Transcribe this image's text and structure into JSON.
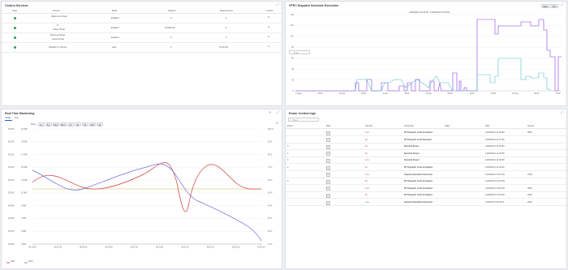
{
  "colors": {
    "ok": "#2e9b5c",
    "purple": "#8c3ce6",
    "teal": "#54c2d0",
    "red": "#d03a3a",
    "blue": "#6b6bd8",
    "olive": "#b9b94a"
  },
  "control_services": {
    "title": "Control Services",
    "columns": [
      "State",
      "Service",
      "Mode",
      "Setpoint",
      "Measurement",
      "Control"
    ],
    "rows": [
      {
        "service": "Reference Power",
        "sub": "",
        "mode": "Enabled",
        "setpoint": "0",
        "measurement": "0"
      },
      {
        "service": "Fr",
        "sub": "Active Power",
        "mode": "Enabled",
        "setpoint": "70,000 kW",
        "measurement": "0"
      },
      {
        "service": "Ramp-up Reset",
        "sub": "Active Power",
        "mode": "Enabled",
        "setpoint": "0",
        "measurement": "0"
      },
      {
        "service": "Dispatch P: Service",
        "sub": "",
        "mode": "Auto",
        "setpoint": "0",
        "measurement": "70,00 kW"
      }
    ]
  },
  "vpp": {
    "title": "VPPC Dispatch Schedule Execution",
    "buttons": [
      "Table",
      "Plot"
    ],
    "legend": "14/09/2021 00:26:59 - 14/09/2021 00:26:59",
    "search_placeholder": "Filter",
    "y_ticks": [
      "140",
      "120",
      "100",
      "80",
      "60",
      "40",
      "20",
      "0"
    ],
    "x_ticks": [
      "11 Sep",
      "18:00",
      "12 Sep",
      "06:00",
      "12:00",
      "18:00",
      "13 Sep",
      "06:00",
      "12:00",
      "18:00",
      "14 Sep",
      "06:00",
      "12:00"
    ]
  },
  "realtime": {
    "title": "Real Time Monitoring",
    "tabs": [
      "Prop",
      "Ana"
    ],
    "zoom_label": "Zoom",
    "zoom_buttons": [
      "1m",
      "5m",
      "10m",
      "30m",
      "1h",
      "3h",
      "6h",
      "12h",
      "All"
    ],
    "y_left_ticks": [
      "50.050",
      "50.040",
      "50.030",
      "50.020",
      "50.010",
      "50.000",
      "49.990",
      "49.980",
      "49.970",
      "49.960"
    ],
    "y_mid_ticks": [
      "21 MW",
      "19 MW",
      "17 MW",
      "15 MW",
      "13 MW",
      "11 MW",
      "9 MW",
      "7 MW",
      "5 MW",
      "3 MW"
    ],
    "y_right_ticks": [
      "100 %",
      "90 %",
      "80 %",
      "70 %",
      "60 %",
      "50 %",
      "40 %",
      "30 %",
      "20 %",
      "10 %"
    ],
    "x_ticks": [
      "08:10:40",
      "08:10:45",
      "08:10:50",
      "08:10:55",
      "08:11:00",
      "08:11:05",
      "08:11:10",
      "08:11:15",
      "08:11:20",
      "08:11:25"
    ],
    "legend": [
      "SOF",
      "SOC"
    ]
  },
  "log": {
    "title": "Power Control logs",
    "search_placeholder": "Filter",
    "columns": [
      "Event",
      "Role",
      "Severity",
      "Parameter",
      "Value",
      "Date",
      "Source"
    ],
    "rows": [
      {
        "event": "",
        "severity": "Low",
        "parameter": "RT Dispatch Limit Activation",
        "value": "",
        "date": "14/09/2021 11:26:59",
        "source": "2000"
      },
      {
        "event": "",
        "severity": "Hi",
        "parameter": "RT Dispatch Limit Reached",
        "value": "",
        "date": "14/09/2021 11:13:39",
        "source": ""
      },
      {
        "event": "0",
        "severity": "Hi",
        "parameter": "Nominal Power",
        "value": "",
        "date": "14/09/2021 11:26:59",
        "source": ""
      },
      {
        "event": "1",
        "severity": "Hi",
        "parameter": "Nominal Power",
        "value": "",
        "date": "14/09/2021 11:26:59",
        "source": ""
      },
      {
        "event": "0",
        "severity": "Low",
        "parameter": "Nominal Power",
        "value": "",
        "date": "14/09/2021 11:06:59",
        "source": ""
      },
      {
        "event": "2",
        "severity": "Hi",
        "parameter": "RT Dispatch Limit Activation",
        "value": "",
        "date": "14/09/2021 11:03:00",
        "source": ""
      },
      {
        "event": "",
        "severity": "Low",
        "parameter": "Setpoint Deviation Received",
        "value": "",
        "date": "14/09/2021 10:51:39",
        "source": "1000"
      },
      {
        "event": "0",
        "severity": "Hi",
        "parameter": "RT Dispatch Limit Activation",
        "value": "",
        "date": "14/09/2021 10:26:59",
        "source": ""
      },
      {
        "event": "",
        "severity": "Low",
        "parameter": "RT Dispatch Limit Activation",
        "value": "",
        "date": "14/09/2021 10:00:39",
        "source": "2000"
      },
      {
        "event": "",
        "severity": "Hi",
        "parameter": "RT Dispatch Limit Activation",
        "value": "",
        "date": "14/09/2021 10:00:00",
        "source": "2000"
      },
      {
        "event": "",
        "severity": "Low",
        "parameter": "Setpoint Deviation Received",
        "value": "",
        "date": "14/09/2021 09:45:11",
        "source": "2000"
      }
    ]
  }
}
